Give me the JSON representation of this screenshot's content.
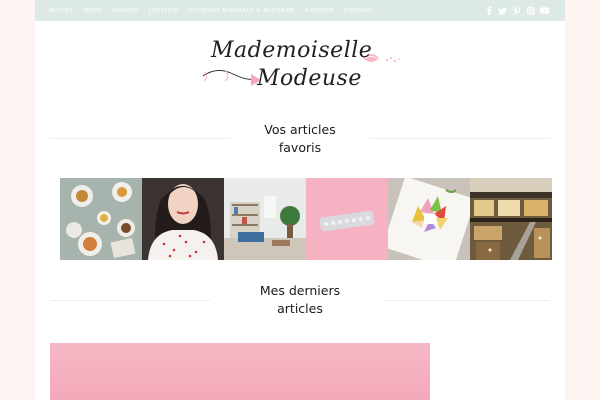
{
  "nav": {
    "items": [
      "ACCUEIL",
      "MODE",
      "VOYAGES",
      "LIFESTYLE",
      "CITYGUIDE BORDEAUX & AQUITAINE",
      "A PROPOS",
      "CONTACT"
    ],
    "social_icons": [
      "facebook-icon",
      "twitter-icon",
      "pinterest-icon",
      "instagram-icon",
      "youtube-icon"
    ]
  },
  "logo": {
    "line1": "Mademoiselle",
    "line2": "Modeuse"
  },
  "favorites": {
    "title_line1": "Vos articles",
    "title_line2": "favoris",
    "tiles": [
      "cafe-table-image",
      "woman-portrait-image",
      "living-room-image",
      "pink-pills-image",
      "macarons-image",
      "shopping-mall-image"
    ]
  },
  "latest": {
    "title_line1": "Mes derniers",
    "title_line2": "articles"
  },
  "colors": {
    "nav_bg": "#dce9e4",
    "page_bg": "#fdf4f1",
    "accent_pink": "#f4a9ba"
  }
}
